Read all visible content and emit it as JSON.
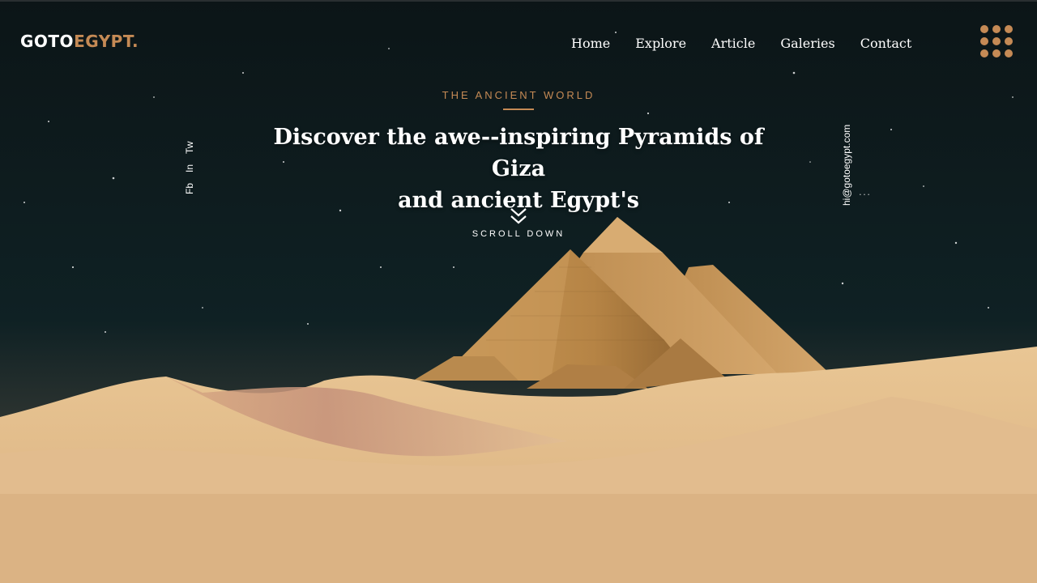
{
  "logo": {
    "part1": "GOTO",
    "part2": "EGYPT."
  },
  "nav": {
    "items": [
      {
        "label": "Home"
      },
      {
        "label": "Explore"
      },
      {
        "label": "Article"
      },
      {
        "label": "Galeries"
      },
      {
        "label": "Contact"
      }
    ]
  },
  "menu_icon": "grid-dots-icon",
  "hero": {
    "eyebrow": "THE ANCIENT WORLD",
    "title_line1": "Discover the awe--inspiring Pyramids of Giza",
    "title_line2": "and ancient Egypt's",
    "scroll_label": "SCROLL DOWN",
    "scroll_icon": "double-chevron-down-icon"
  },
  "social": {
    "items": [
      {
        "label": "Fb"
      },
      {
        "label": "In"
      },
      {
        "label": "Tw"
      }
    ]
  },
  "contact": {
    "email": "hi@gotoegypt.com"
  },
  "colors": {
    "accent": "#c58a55",
    "sky": "#0c1a1c",
    "sand": "#dcb484",
    "text": "#ffffff"
  }
}
